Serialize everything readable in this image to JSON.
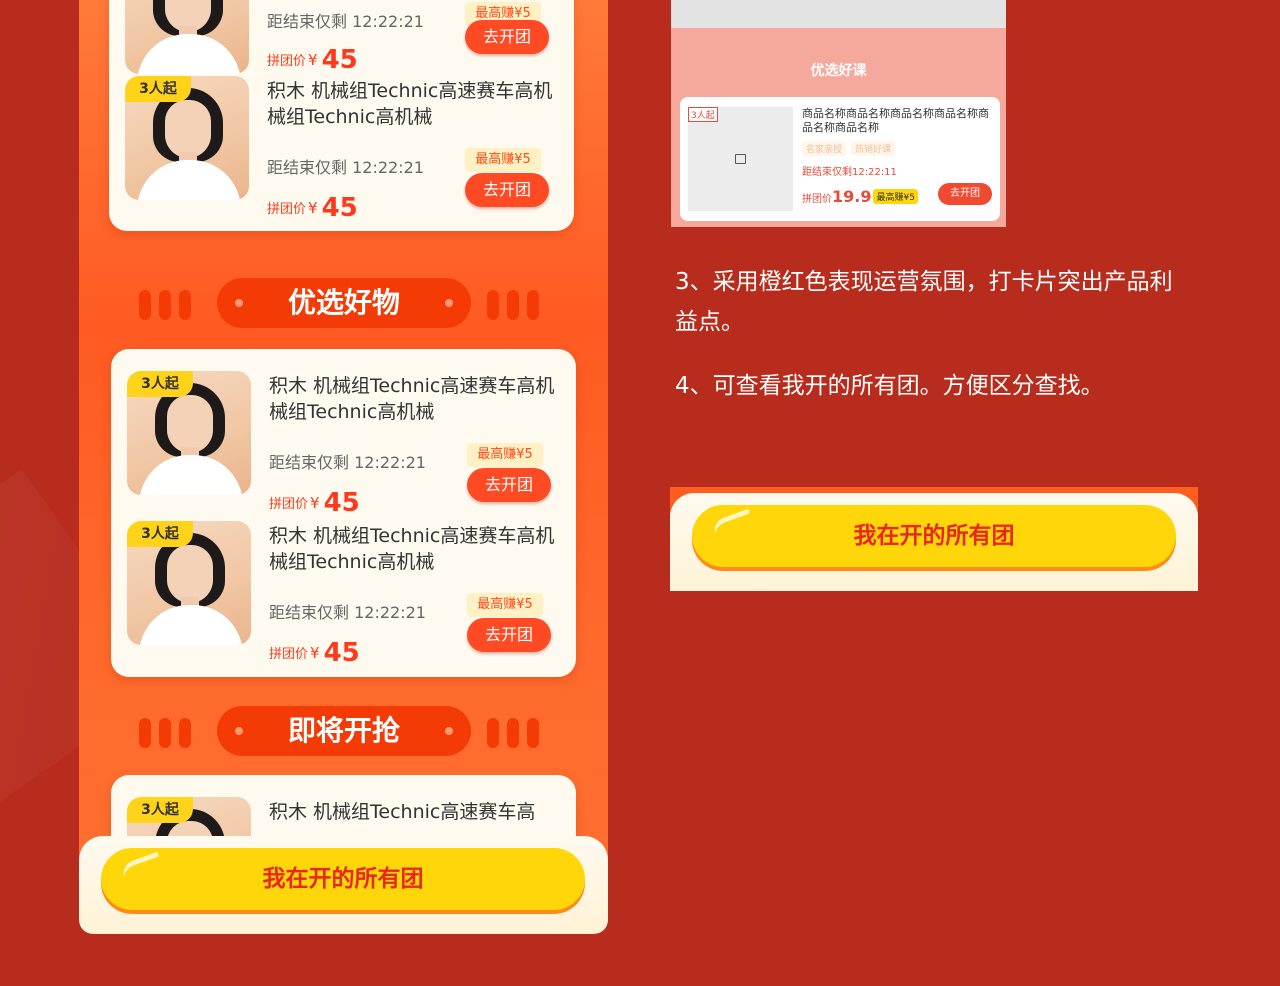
{
  "phone": {
    "items_top": [
      {
        "badge": "",
        "title": "",
        "timer": "距结束仅剩 12:22:21",
        "earn": "最高赚¥5",
        "price_label": "拼团价",
        "currency": "¥",
        "price": "45",
        "button": "去开团"
      },
      {
        "badge": "3人起",
        "title": "积木 机械组Technic高速赛车高机械组Technic高机械",
        "timer": "距结束仅剩 12:22:21",
        "earn": "最高赚¥5",
        "price_label": "拼团价",
        "currency": "¥",
        "price": "45",
        "button": "去开团"
      }
    ],
    "section1_title": "优选好物",
    "items_mid": [
      {
        "badge": "3人起",
        "title": "积木 机械组Technic高速赛车高机械组Technic高机械",
        "timer": "距结束仅剩 12:22:21",
        "earn": "最高赚¥5",
        "price_label": "拼团价",
        "currency": "¥",
        "price": "45",
        "button": "去开团"
      },
      {
        "badge": "3人起",
        "title": "积木 机械组Technic高速赛车高机械组Technic高机械",
        "timer": "距结束仅剩 12:22:21",
        "earn": "最高赚¥5",
        "price_label": "拼团价",
        "currency": "¥",
        "price": "45",
        "button": "去开团"
      }
    ],
    "section2_title": "即将开抢",
    "items_bottom": [
      {
        "badge": "3人起",
        "title": "积木 机械组Technic高速赛车高"
      }
    ],
    "bottom_button": "我在开的所有团"
  },
  "reference_shot": {
    "section_title": "优选好课",
    "badge": "3人起",
    "title": "商品名称商品名称商品名称商品名称商品名称商品名称",
    "tags": [
      "名家亲授",
      "热销好课"
    ],
    "timer": "距结束仅剩12:22:11",
    "price_label": "拼团价",
    "price": "19.9",
    "earn": "最高赚¥5",
    "button": "去开团"
  },
  "notes": {
    "point3": "3、采用橙红色表现运营氛围，打卡片突出产品利益点。",
    "point4": "4、可查看我开的所有团。方便区分查找。"
  },
  "right_button": "我在开的所有团"
}
